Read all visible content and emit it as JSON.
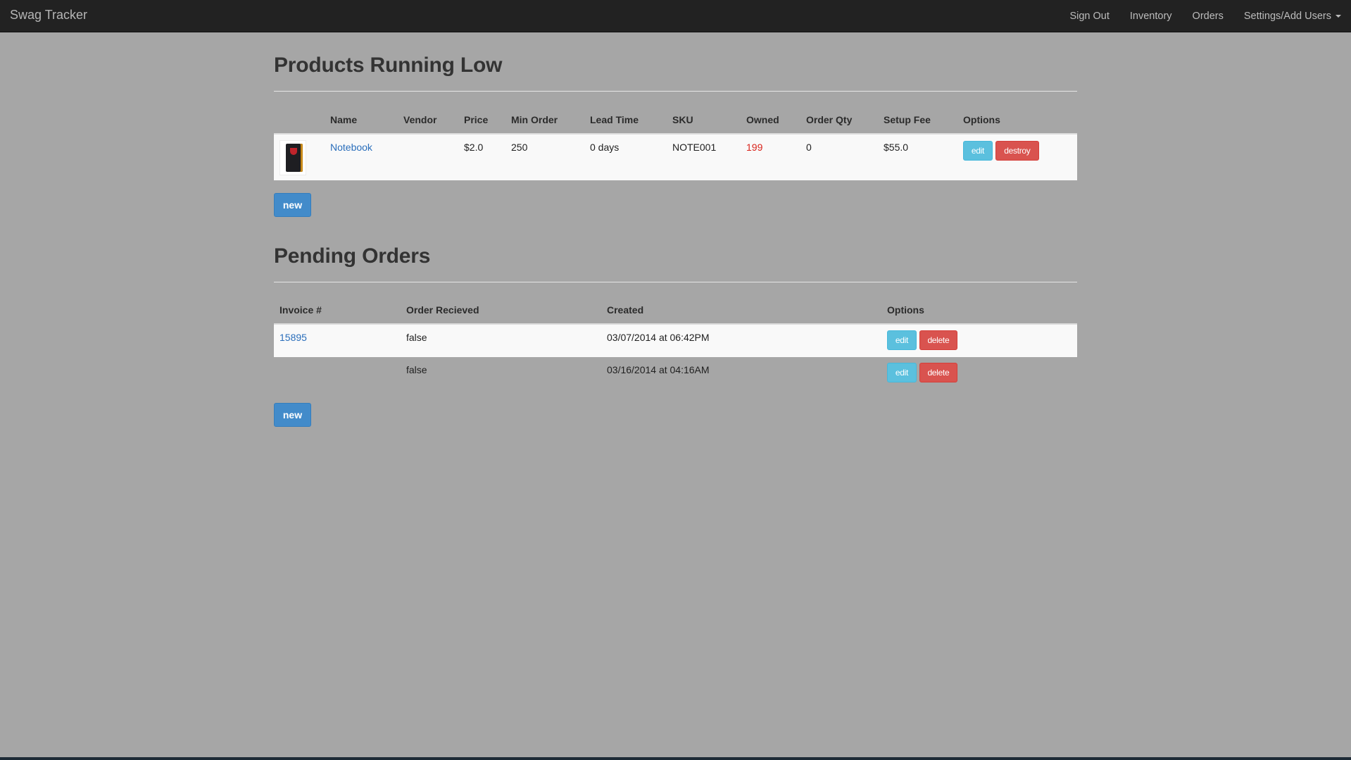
{
  "navbar": {
    "brand": "Swag Tracker",
    "links": [
      "Sign Out",
      "Inventory",
      "Orders",
      "Settings/Add Users"
    ]
  },
  "products": {
    "title": "Products Running Low",
    "columns": [
      "Name",
      "Vendor",
      "Price",
      "Min Order",
      "Lead Time",
      "SKU",
      "Owned",
      "Order Qty",
      "Setup Fee",
      "Options"
    ],
    "rows": [
      {
        "name": "Notebook",
        "vendor": "",
        "price": "$2.0",
        "min_order": "250",
        "lead_time": "0 days",
        "sku": "NOTE001",
        "owned": "199",
        "order_qty": "0",
        "setup_fee": "$55.0",
        "edit_label": "edit",
        "destroy_label": "destroy"
      }
    ],
    "new_label": "new"
  },
  "orders": {
    "title": "Pending Orders",
    "columns": [
      "Invoice #",
      "Order Recieved",
      "Created",
      "Options"
    ],
    "rows": [
      {
        "invoice": "15895",
        "received": "false",
        "created": "03/07/2014 at 06:42PM",
        "edit_label": "edit",
        "delete_label": "delete"
      },
      {
        "invoice": "",
        "received": "false",
        "created": "03/16/2014 at 04:16AM",
        "edit_label": "edit",
        "delete_label": "delete"
      }
    ],
    "new_label": "new"
  },
  "colors": {
    "navbar": "#222222",
    "page_bg": "#a6a6a6",
    "link": "#2a6ebb",
    "low_stock": "#d9241c",
    "btn_primary": "#428bca",
    "btn_info": "#5bc0de",
    "btn_danger": "#d9534f"
  },
  "icons": {
    "product_thumbnail": "notebook-image",
    "dropdown": "caret-down-icon"
  }
}
